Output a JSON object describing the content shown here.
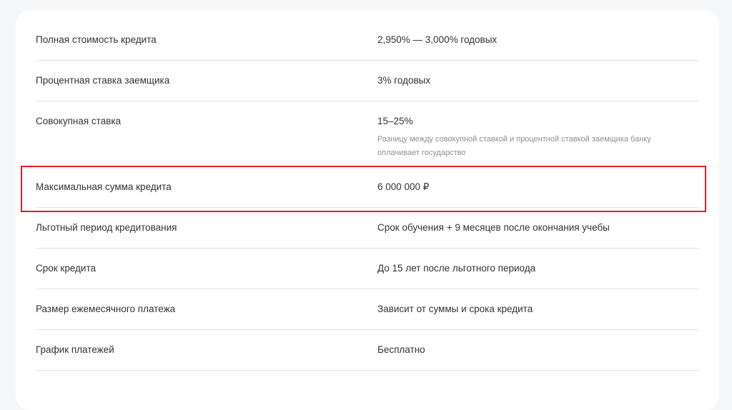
{
  "highlight_color": "#e31e24",
  "rows": [
    {
      "label": "Полная стоимость кредита",
      "value": "2,950% — 3,000% годовых"
    },
    {
      "label": "Процентная ставка заемщика",
      "value": "3% годовых"
    },
    {
      "label": "Совокупная ставка",
      "value": "15–25%",
      "note": "Разницу между совокупной ставкой и процентной ставкой заемщика банку оплачивает государство"
    },
    {
      "label": "Максимальная сумма кредита",
      "value": "6 000 000 ₽",
      "highlighted": true
    },
    {
      "label": "Льготный период кредитования",
      "value": "Срок обучения + 9 месяцев после окончания учебы"
    },
    {
      "label": "Срок кредита",
      "value": "До 15 лет после льготного периода"
    },
    {
      "label": "Размер ежемесячного платежа",
      "value": "Зависит от суммы и срока кредита"
    },
    {
      "label": "График платежей",
      "value": "Бесплатно"
    }
  ]
}
